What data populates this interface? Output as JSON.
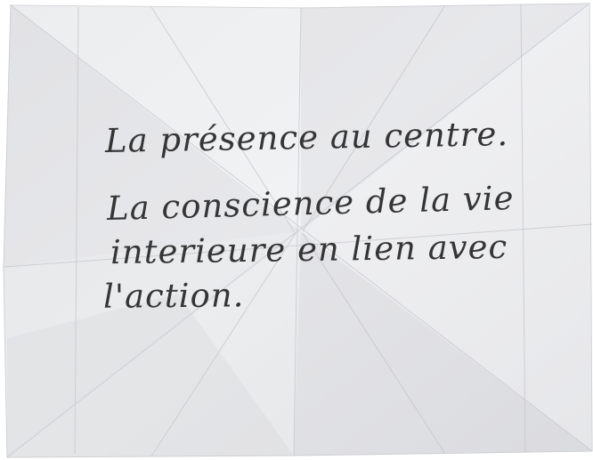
{
  "note": {
    "lines": [
      "La présence au centre.",
      "La conscience de la vie",
      "interieure en lien avec",
      "l'action."
    ]
  },
  "colors": {
    "paper": "#e9eaec",
    "paper_shadow": "#d5d6d9",
    "ink": "#262626",
    "background": "#ffffff"
  }
}
